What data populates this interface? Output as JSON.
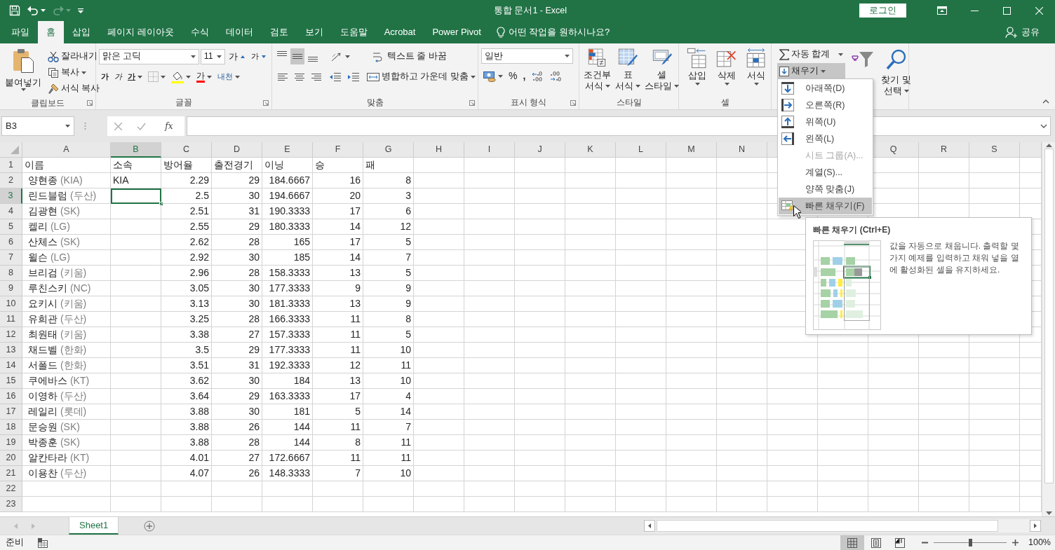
{
  "title_bar": {
    "title": "통합 문서1 - Excel",
    "sign_in": "로그인",
    "redo_disabled": true
  },
  "tabs": [
    {
      "label": "파일",
      "selected": false
    },
    {
      "label": "홈",
      "selected": true
    },
    {
      "label": "삽입",
      "selected": false
    },
    {
      "label": "페이지 레이아웃",
      "selected": false
    },
    {
      "label": "수식",
      "selected": false
    },
    {
      "label": "데이터",
      "selected": false
    },
    {
      "label": "검토",
      "selected": false
    },
    {
      "label": "보기",
      "selected": false
    },
    {
      "label": "도움말",
      "selected": false
    },
    {
      "label": "Acrobat",
      "selected": false
    },
    {
      "label": "Power Pivot",
      "selected": false
    }
  ],
  "tell_me": "어떤 작업을 원하시나요?",
  "share": "공유",
  "ribbon": {
    "clipboard": {
      "label": "클립보드",
      "paste": "붙여넣기",
      "cut": "잘라내기",
      "copy": "복사",
      "format_painter": "서식 복사"
    },
    "font": {
      "label": "글꼴",
      "font_name": "맑은 고딕",
      "font_size": "11",
      "grow": "가",
      "shrink": "가",
      "bold": "가",
      "italic": "가",
      "underline": "가",
      "font_color": "가",
      "phonetic": "내천"
    },
    "alignment": {
      "label": "맞춤",
      "vertical_align": [
        {
          "kind": "top",
          "selected": false
        },
        {
          "kind": "middle",
          "selected": true
        },
        {
          "kind": "bottom",
          "selected": false
        }
      ],
      "wrap": "텍스트 줄 바꿈",
      "merge": "병합하고 가운데 맞춤"
    },
    "number": {
      "label": "표시 형식",
      "format": "일반",
      "percent": "%",
      "comma": ","
    },
    "styles": {
      "label": "스타일",
      "buttons": [
        {
          "kind": "conditional",
          "lines": [
            "조건부",
            "서식"
          ]
        },
        {
          "kind": "table",
          "lines": [
            "표",
            "서식"
          ]
        },
        {
          "kind": "cell",
          "lines": [
            "셀",
            "스타일"
          ]
        }
      ]
    },
    "cells": {
      "label": "셀",
      "buttons": [
        {
          "kind": "insert",
          "label": "삽입"
        },
        {
          "kind": "delete",
          "label": "삭제"
        },
        {
          "kind": "format",
          "label": "서식"
        }
      ]
    },
    "editing": {
      "autosum": "자동 합계",
      "fill": {
        "label": "채우기",
        "expanded": true
      },
      "find": [
        "찾기 및",
        "선택"
      ]
    }
  },
  "formula_bar": {
    "name_box": "B3",
    "function": "fx"
  },
  "sheet": {
    "columns_left": [
      {
        "label": "A",
        "selected": false
      },
      {
        "label": "B",
        "selected": true
      },
      {
        "label": "C",
        "selected": false
      },
      {
        "label": "D",
        "selected": false
      },
      {
        "label": "E",
        "selected": false
      },
      {
        "label": "F",
        "selected": false
      },
      {
        "label": "G",
        "selected": false
      },
      {
        "label": "H",
        "selected": false
      },
      {
        "label": "I",
        "selected": false
      },
      {
        "label": "J",
        "selected": false
      },
      {
        "label": "K",
        "selected": false
      },
      {
        "label": "L",
        "selected": false
      },
      {
        "label": "M",
        "selected": false
      },
      {
        "label": "N",
        "selected": false
      }
    ],
    "columns_right": [
      {
        "label": "Q",
        "selected": false
      },
      {
        "label": "R",
        "selected": false
      },
      {
        "label": "S",
        "selected": false
      }
    ],
    "rows": [
      {
        "number": "1",
        "selected": false,
        "kind": "header",
        "cells": [
          "이름",
          "소속",
          "방어율",
          "출전경기",
          "이닝",
          "승",
          "패"
        ]
      },
      {
        "number": "2",
        "selected": false,
        "kind": "data",
        "name": "양현종",
        "team": "(KIA)",
        "affiliation": "KIA",
        "values": [
          "2.29",
          "29",
          "184.6667",
          "16",
          "8"
        ]
      },
      {
        "number": "3",
        "selected": true,
        "kind": "data",
        "name": "린드블럼",
        "team": "(두산)",
        "values": [
          "2.5",
          "30",
          "194.6667",
          "20",
          "3"
        ]
      },
      {
        "number": "4",
        "selected": false,
        "kind": "data",
        "name": "김광현",
        "team": "(SK)",
        "values": [
          "2.51",
          "31",
          "190.3333",
          "17",
          "6"
        ]
      },
      {
        "number": "5",
        "selected": false,
        "kind": "data",
        "name": "켈리",
        "team": "(LG)",
        "values": [
          "2.55",
          "29",
          "180.3333",
          "14",
          "12"
        ]
      },
      {
        "number": "6",
        "selected": false,
        "kind": "data",
        "name": "산체스",
        "team": "(SK)",
        "values": [
          "2.62",
          "28",
          "165",
          "17",
          "5"
        ]
      },
      {
        "number": "7",
        "selected": false,
        "kind": "data",
        "name": "윌슨",
        "team": "(LG)",
        "values": [
          "2.92",
          "30",
          "185",
          "14",
          "7"
        ]
      },
      {
        "number": "8",
        "selected": false,
        "kind": "data",
        "name": "브리검",
        "team": "(키움)",
        "values": [
          "2.96",
          "28",
          "158.3333",
          "13",
          "5"
        ]
      },
      {
        "number": "9",
        "selected": false,
        "kind": "data",
        "name": "루친스키",
        "team": "(NC)",
        "values": [
          "3.05",
          "30",
          "177.3333",
          "9",
          "9"
        ]
      },
      {
        "number": "10",
        "selected": false,
        "kind": "data",
        "name": "요키시",
        "team": "(키움)",
        "values": [
          "3.13",
          "30",
          "181.3333",
          "13",
          "9"
        ]
      },
      {
        "number": "11",
        "selected": false,
        "kind": "data",
        "name": "유희관",
        "team": "(두산)",
        "values": [
          "3.25",
          "28",
          "166.3333",
          "11",
          "8"
        ]
      },
      {
        "number": "12",
        "selected": false,
        "kind": "data",
        "name": "최원태",
        "team": "(키움)",
        "values": [
          "3.38",
          "27",
          "157.3333",
          "11",
          "5"
        ]
      },
      {
        "number": "13",
        "selected": false,
        "kind": "data",
        "name": "채드벨",
        "team": "(한화)",
        "values": [
          "3.5",
          "29",
          "177.3333",
          "11",
          "10"
        ]
      },
      {
        "number": "14",
        "selected": false,
        "kind": "data",
        "name": "서폴드",
        "team": "(한화)",
        "values": [
          "3.51",
          "31",
          "192.3333",
          "12",
          "11"
        ]
      },
      {
        "number": "15",
        "selected": false,
        "kind": "data",
        "name": "쿠에바스",
        "team": "(KT)",
        "values": [
          "3.62",
          "30",
          "184",
          "13",
          "10"
        ]
      },
      {
        "number": "16",
        "selected": false,
        "kind": "data",
        "name": "이영하",
        "team": "(두산)",
        "values": [
          "3.64",
          "29",
          "163.3333",
          "17",
          "4"
        ]
      },
      {
        "number": "17",
        "selected": false,
        "kind": "data",
        "name": "레일리",
        "team": "(롯데)",
        "values": [
          "3.88",
          "30",
          "181",
          "5",
          "14"
        ]
      },
      {
        "number": "18",
        "selected": false,
        "kind": "data",
        "name": "문승원",
        "team": "(SK)",
        "values": [
          "3.88",
          "26",
          "144",
          "11",
          "7"
        ]
      },
      {
        "number": "19",
        "selected": false,
        "kind": "data",
        "name": "박종훈",
        "team": "(SK)",
        "values": [
          "3.88",
          "28",
          "144",
          "8",
          "11"
        ]
      },
      {
        "number": "20",
        "selected": false,
        "kind": "data",
        "name": "알칸타라",
        "team": "(KT)",
        "values": [
          "4.01",
          "27",
          "172.6667",
          "11",
          "11"
        ]
      },
      {
        "number": "21",
        "selected": false,
        "kind": "data",
        "name": "이용찬",
        "team": "(두산)",
        "values": [
          "4.07",
          "26",
          "148.3333",
          "7",
          "10"
        ]
      },
      {
        "number": "22",
        "selected": false,
        "kind": "empty"
      },
      {
        "number": "23",
        "selected": false,
        "kind": "empty"
      }
    ]
  },
  "sheet_tabs": [
    {
      "label": "Sheet1",
      "selected": true
    }
  ],
  "status_bar": {
    "status": "준비",
    "views": [
      {
        "kind": "normal",
        "selected": true
      },
      {
        "kind": "page_layout",
        "selected": false
      },
      {
        "kind": "page_break",
        "selected": false
      }
    ],
    "zoom": {
      "level": 0.5,
      "reading": "100%"
    }
  },
  "fill_menu": {
    "items": [
      {
        "label": "아래쪽(D)",
        "kind": "down",
        "disabled": false,
        "selected": false
      },
      {
        "label": "오른쪽(R)",
        "kind": "right",
        "disabled": false,
        "selected": false
      },
      {
        "label": "위쪽(U)",
        "kind": "up",
        "disabled": false,
        "selected": false
      },
      {
        "label": "왼쪽(L)",
        "kind": "left",
        "disabled": false,
        "selected": false
      },
      {
        "label": "시트 그룹(A)...",
        "kind": "plain",
        "disabled": true,
        "selected": false
      },
      {
        "label": "계열(S)...",
        "kind": "plain",
        "disabled": false,
        "selected": false
      },
      {
        "label": "양쪽 맞춤(J)",
        "kind": "plain",
        "disabled": false,
        "selected": false
      },
      {
        "label": "빠른 채우기(F)",
        "kind": "flash",
        "disabled": false,
        "selected": true
      }
    ]
  },
  "tooltip": {
    "title": "빠른 채우기 (Ctrl+E)",
    "body": "값을 자동으로 채웁니다. 출력할 몇 가지 예제를 입력하고 채워 넣을 열에 활성화된 셀을 유지하세요."
  }
}
